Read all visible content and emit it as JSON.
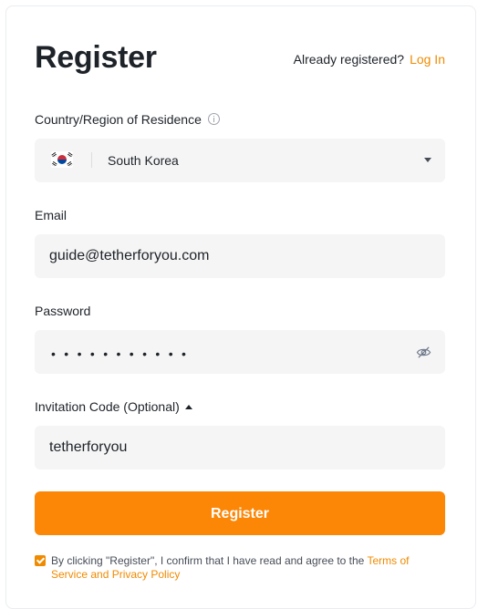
{
  "header": {
    "title": "Register",
    "already_text": "Already registered?",
    "login_link": "Log In"
  },
  "country": {
    "label": "Country/Region of Residence",
    "info_icon": "info-icon",
    "flag_icon": "south-korea-flag-icon",
    "selected": "South Korea",
    "dropdown_icon": "caret-down-icon"
  },
  "email": {
    "label": "Email",
    "value": "guide@tetherforyou.com"
  },
  "password": {
    "label": "Password",
    "masked_value": "•••••••••••",
    "toggle_icon": "eye-slash-icon"
  },
  "invitation": {
    "label": "Invitation Code (Optional)",
    "toggle_icon": "caret-up-icon",
    "value": "tetherforyou"
  },
  "submit": {
    "label": "Register"
  },
  "agreement": {
    "checked": true,
    "text": "By clicking \"Register\", I confirm that I have read and agree to the ",
    "link": "Terms of Service and Privacy Policy"
  },
  "colors": {
    "accent": "#fc8605",
    "link": "#f08a00",
    "field_bg": "#f5f5f5",
    "text": "#1e2329"
  }
}
